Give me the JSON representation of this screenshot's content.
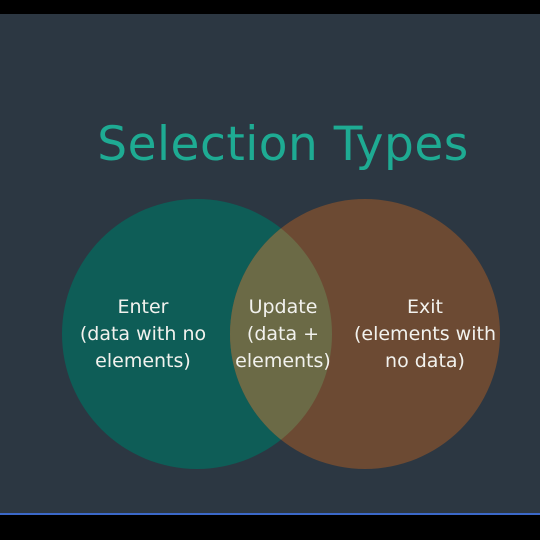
{
  "title": "Selection Types",
  "regions": {
    "enter": "Enter\n(data with no\nelements)",
    "update": "Update\n(data +\nelements)",
    "exit": "Exit\n(elements with\nno data)"
  },
  "colors": {
    "background": "#2c3742",
    "title": "#1eab93",
    "enter_circle": "#0e5d57",
    "exit_circle": "#6c4a33",
    "overlap": "#6b6a46",
    "text": "#f2f2ee"
  }
}
